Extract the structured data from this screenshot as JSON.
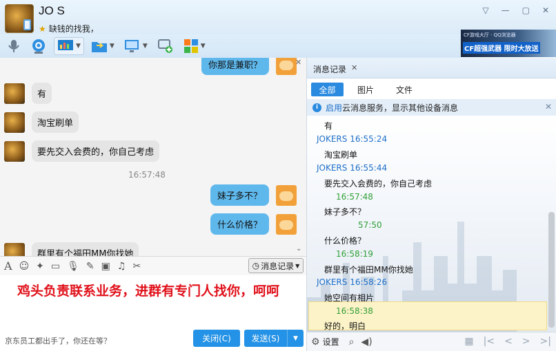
{
  "header": {
    "contact_name": "JO      S",
    "signature": "缺钱的找我，",
    "window_controls": [
      "▽",
      "—",
      "▢",
      "✕"
    ]
  },
  "ad_banner": {
    "top_text": "CF游戏大厅 · QQ浏览器",
    "main_text": "CF超强武器 限时大放送"
  },
  "chat": {
    "messages": [
      {
        "side": "out",
        "text": "你那是兼职？"
      },
      {
        "side": "in",
        "text": "有"
      },
      {
        "side": "in",
        "text": "淘宝刷单"
      },
      {
        "side": "in",
        "text": "要先交入会费的，你自己考虑"
      },
      {
        "side": "out",
        "text": "妹子多不？"
      },
      {
        "side": "out",
        "text": "什么价格？"
      },
      {
        "side": "in",
        "text": "群里有个福田MM你找她"
      }
    ],
    "time_divider": "16:57:48"
  },
  "input_toolbar": {
    "history_button": "消息记录"
  },
  "input": {
    "text": "鸡头负责联系业务，进群有专门人找你，呵呵"
  },
  "footer": {
    "ad_line": "京东员工都出手了，你还在等？",
    "close_label": "关闭(C)",
    "send_label": "发送(S)"
  },
  "history_panel": {
    "title": "消息记录",
    "tabs": [
      "全部",
      "图片",
      "文件"
    ],
    "notice_link": "启用",
    "notice_text": "云消息服务，显示其他设备消息",
    "entries": [
      {
        "type": "msg",
        "text": "有"
      },
      {
        "type": "sender",
        "text": "JOKERS 16:55:24"
      },
      {
        "type": "msg",
        "text": "淘宝刷单"
      },
      {
        "type": "sender",
        "text": "JOKERS 16:55:44"
      },
      {
        "type": "msg",
        "text": "要先交入会费的，你自己考虑"
      },
      {
        "type": "sender-g",
        "text": "16:57:48"
      },
      {
        "type": "msg",
        "text": "妹子多不？"
      },
      {
        "type": "sender-g",
        "text": "57:50"
      },
      {
        "type": "msg",
        "text": "什么价格？"
      },
      {
        "type": "sender-g",
        "text": "16:58:19"
      },
      {
        "type": "msg",
        "text": "群里有个福田MM你找她"
      },
      {
        "type": "sender",
        "text": "JOKERS 16:58:26"
      },
      {
        "type": "msg",
        "text": "她空间有相片"
      },
      {
        "type": "sender-g",
        "text": "16:58:38"
      },
      {
        "type": "msg",
        "text": "好的，明白"
      }
    ],
    "settings_label": "设置"
  }
}
